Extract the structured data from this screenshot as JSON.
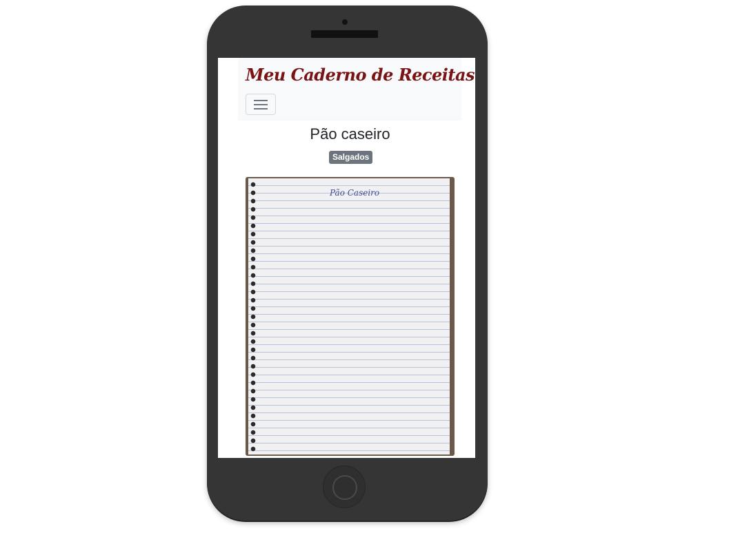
{
  "app": {
    "brand": "Meu Caderno de Receitas"
  },
  "recipe": {
    "title": "Pão caseiro",
    "category_badge": "Salgados",
    "image": {
      "description_icon": "handwritten-recipe-photo",
      "handwriting_title": "Pão Caseiro"
    }
  },
  "colors": {
    "brand": "#7a1313",
    "badge_bg": "#6c757d",
    "phone_body": "#353535"
  }
}
